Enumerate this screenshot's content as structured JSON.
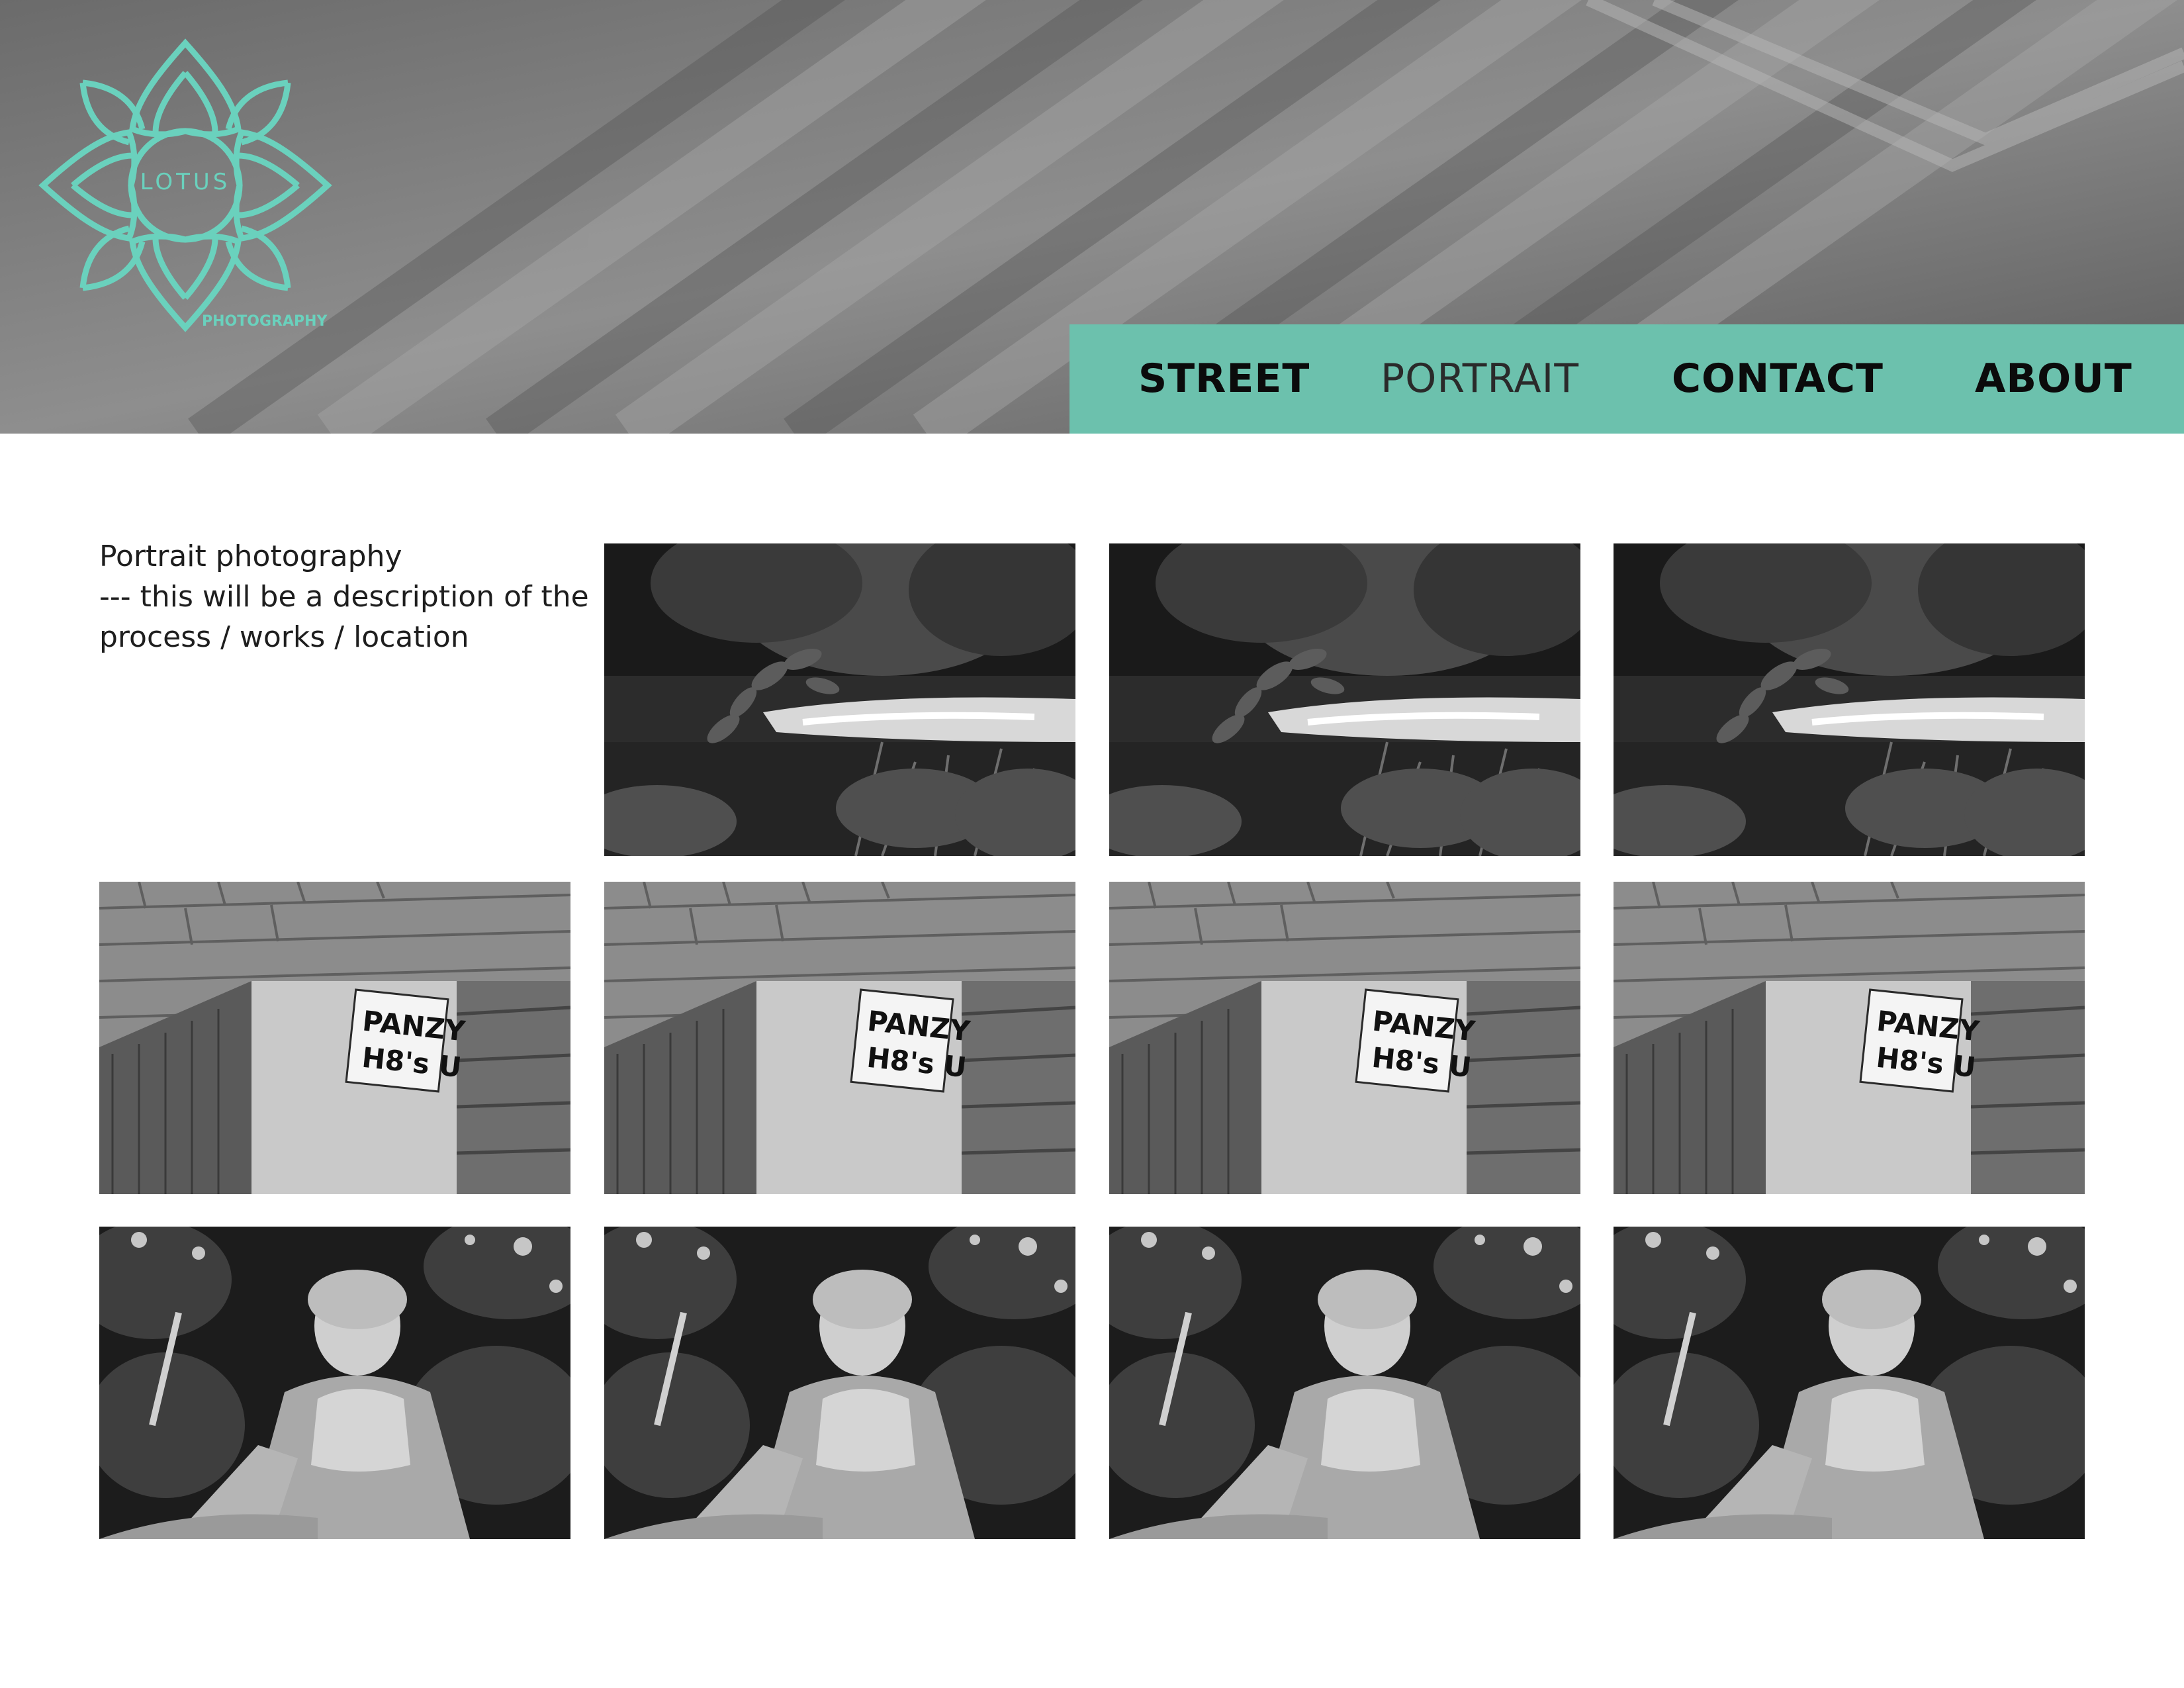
{
  "brand": {
    "name": "LOTUS",
    "tagline": "PHOTOGRAPHY",
    "accent_color": "#6ad1bd",
    "nav_color": "#6cc1ad",
    "logo_icon": "lotus-flower-icon"
  },
  "nav": {
    "street": "STREET",
    "portrait": "PORTRAIT",
    "contact": "CONTACT",
    "about": "ABOUT",
    "active": "PORTRAIT"
  },
  "intro": {
    "line1": "Portrait photography",
    "line2": "--- this will be a description of the",
    "line3": "process / works / location"
  },
  "gallery": {
    "rows": [
      {
        "subject": "river-foliage",
        "count": 3
      },
      {
        "subject": "panzy-sticker",
        "count": 4,
        "sticker_line1": "PANZY",
        "sticker_line2": "H8's U"
      },
      {
        "subject": "statue",
        "count": 4
      }
    ]
  }
}
